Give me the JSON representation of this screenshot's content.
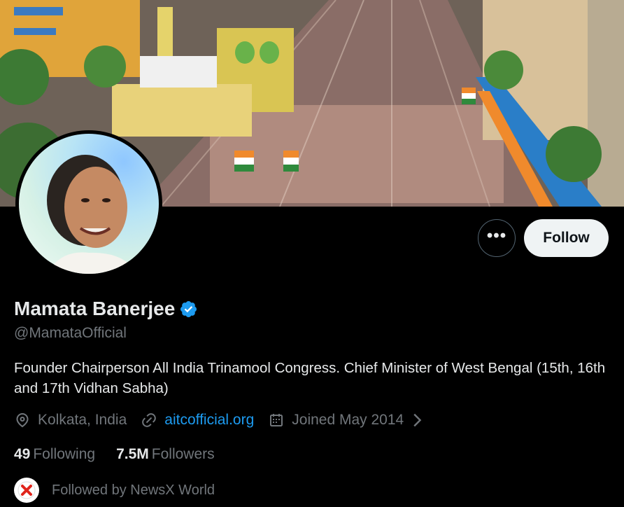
{
  "profile": {
    "name": "Mamata Banerjee",
    "handle": "@MamataOfficial",
    "bio": "Founder Chairperson All India Trinamool Congress. Chief Minister of West Bengal (15th, 16th and 17th Vidhan Sabha)",
    "location": "Kolkata, India",
    "website": "aitcofficial.org",
    "joined": "Joined May 2014",
    "verified": true
  },
  "actions": {
    "follow_label": "Follow",
    "more_label": "•••"
  },
  "stats": {
    "following_count": "49",
    "following_label": "Following",
    "followers_count": "7.5M",
    "followers_label": "Followers"
  },
  "followed_by": {
    "text": "Followed by NewsX World"
  },
  "colors": {
    "background": "#000000",
    "accent": "#1d9bf0",
    "muted": "#71767b",
    "button_bg": "#eff3f4"
  },
  "icons": {
    "location": "location-pin-icon",
    "link": "link-icon",
    "calendar": "calendar-icon",
    "verified": "verified-badge-icon",
    "chevron": "chevron-right-icon"
  }
}
